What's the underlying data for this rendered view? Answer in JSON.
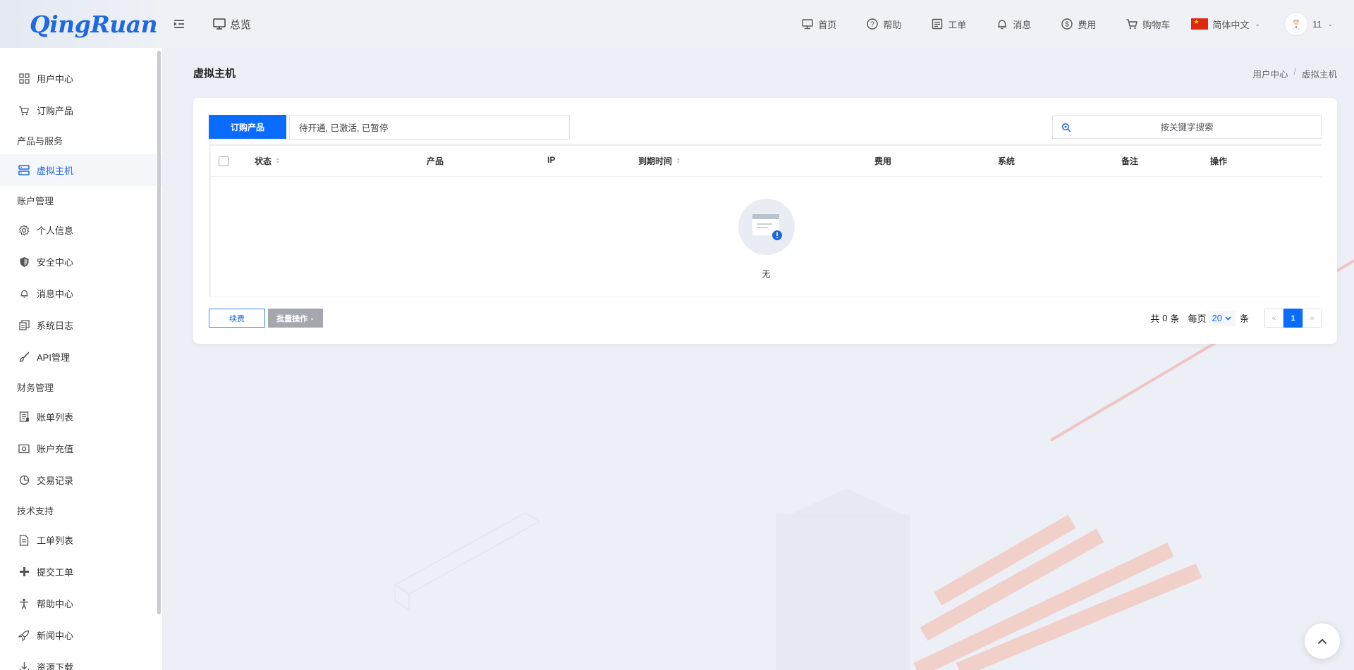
{
  "brand": {
    "logo_text": "QingRuan"
  },
  "header": {
    "overview_label": "总览",
    "nav": [
      {
        "icon": "monitor-icon",
        "label": "首页"
      },
      {
        "icon": "help-circle-icon",
        "label": "帮助"
      },
      {
        "icon": "ticket-icon",
        "label": "工单"
      },
      {
        "icon": "bell-icon",
        "label": "消息"
      },
      {
        "icon": "dollar-icon",
        "label": "费用"
      },
      {
        "icon": "cart-icon",
        "label": "购物车"
      }
    ],
    "language": "简体中文",
    "user_name": "11"
  },
  "sidebar": {
    "user_center": "用户中心",
    "order_product": "订购产品",
    "group_products": "产品与服务",
    "virtual_host": "虚拟主机",
    "group_account": "账户管理",
    "personal_info": "个人信息",
    "security_center": "安全中心",
    "message_center": "消息中心",
    "system_log": "系统日志",
    "api_management": "API管理",
    "group_finance": "财务管理",
    "bill_list": "账单列表",
    "account_recharge": "账户充值",
    "transaction_records": "交易记录",
    "group_support": "技术支持",
    "ticket_list": "工单列表",
    "submit_ticket": "提交工单",
    "help_center": "帮助中心",
    "news_center": "新闻中心",
    "downloads": "资源下载"
  },
  "page": {
    "title": "虚拟主机",
    "breadcrumb": [
      "用户中心",
      "虚拟主机"
    ]
  },
  "toolbar": {
    "order_button": "订购产品",
    "status_filter": "待开通, 已激活, 已暂停",
    "search_placeholder": "按关键字搜索"
  },
  "table": {
    "columns": {
      "status": "状态",
      "product": "产品",
      "ip": "IP",
      "expiry": "到期时间",
      "cost": "费用",
      "system": "系统",
      "notes": "备注",
      "actions": "操作"
    },
    "rows": [],
    "empty_text": "无"
  },
  "footer": {
    "renew_button": "续费",
    "batch_button": "批量操作",
    "total_prefix": "共",
    "total_count": "0",
    "total_suffix": "条",
    "per_page_label": "每页",
    "per_page_value": "20",
    "per_page_suffix": "条",
    "prev": "«",
    "current_page": "1",
    "next": "»"
  },
  "colors": {
    "accent": "#0a6cff",
    "sidebar_bg": "#ffffff",
    "page_bg": "#eceff5"
  }
}
